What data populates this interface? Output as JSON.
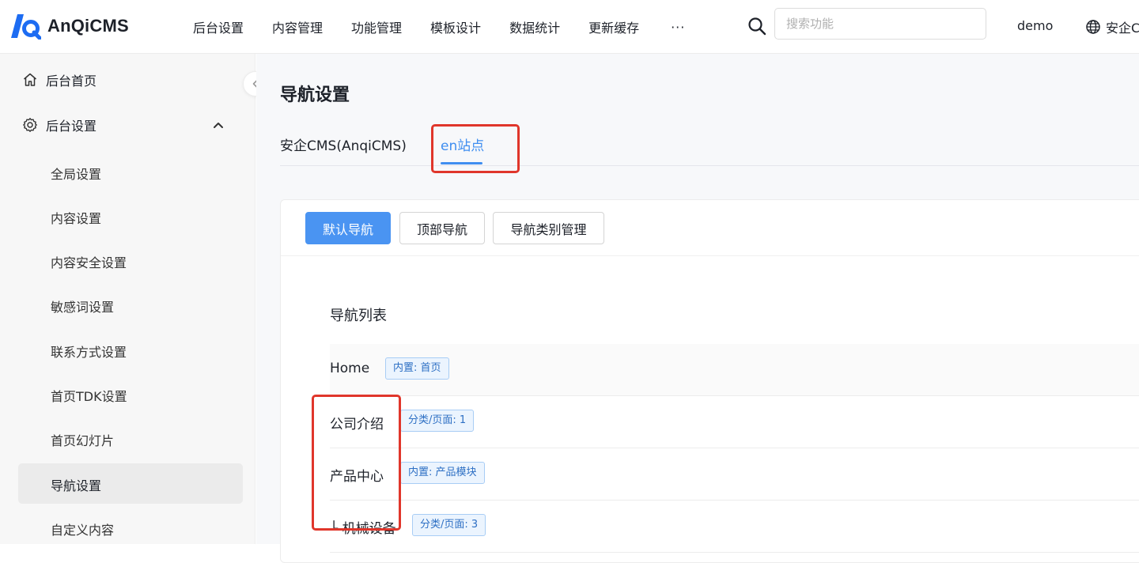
{
  "app": {
    "name": "AnQiCMS"
  },
  "topnav": {
    "items": [
      "后台设置",
      "内容管理",
      "功能管理",
      "模板设计",
      "数据统计",
      "更新缓存"
    ],
    "more": "···",
    "search_placeholder": "搜索功能",
    "user": "demo",
    "site": "安企C"
  },
  "sidebar": {
    "home": "后台首页",
    "settings": "后台设置",
    "sub_items": [
      "全局设置",
      "内容设置",
      "内容安全设置",
      "敏感词设置",
      "联系方式设置",
      "首页TDK设置",
      "首页幻灯片",
      "导航设置",
      "自定义内容"
    ],
    "active": "导航设置"
  },
  "main": {
    "title": "导航设置",
    "site_tabs": [
      "安企CMS(AnqiCMS)",
      "en站点"
    ],
    "nav_tabs": [
      "默认导航",
      "顶部导航",
      "导航类别管理"
    ],
    "list_title": "导航列表",
    "rows": [
      {
        "name": "Home",
        "tag": "内置: 首页"
      },
      {
        "name": "公司介绍",
        "tag": "分类/页面: 1"
      },
      {
        "name": "产品中心",
        "tag": "内置: 产品模块"
      },
      {
        "name": "└ 机械设备",
        "tag": "分类/页面: 3"
      }
    ]
  },
  "colors": {
    "accent": "#3f8ef0",
    "primary_button": "#4a94f2",
    "highlight_box": "#e0362b"
  }
}
